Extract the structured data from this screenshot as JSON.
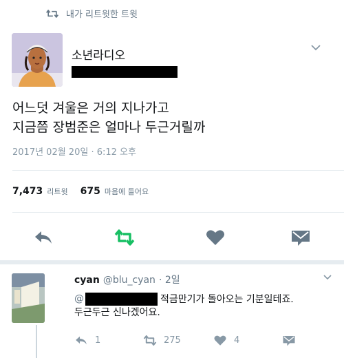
{
  "retweet_context": {
    "label": "내가 리트윗한 트윗"
  },
  "tweet": {
    "name": "소년라디오",
    "text_lines": [
      "어느덧 겨울은 거의 지나가고",
      "지금쯤 장범준은 얼마나 두근거릴까"
    ],
    "timestamp": "2017년 02월 20일 · 6:12 오후",
    "stats": {
      "retweets": {
        "count": "7,473",
        "label": "리트윗"
      },
      "likes": {
        "count": "675",
        "label": "마음에 들어요"
      }
    },
    "icons": {
      "reply": "reply-icon",
      "retweet": "retweet-icon",
      "like": "heart-icon",
      "dm": "envelope-icon"
    },
    "colors": {
      "retweet_active": "#17bf63",
      "icon_gray": "#657786"
    }
  },
  "reply_tweet": {
    "name": "cyan",
    "handle": "@blu_cyan",
    "time": "· 2일",
    "mention_prefix": "@",
    "line1": "적금만기가 돌아오는 기분일테죠.",
    "line2": "두근두근 신나겠어요.",
    "counts": {
      "reply": "1",
      "retweet": "275",
      "like": "4"
    }
  }
}
